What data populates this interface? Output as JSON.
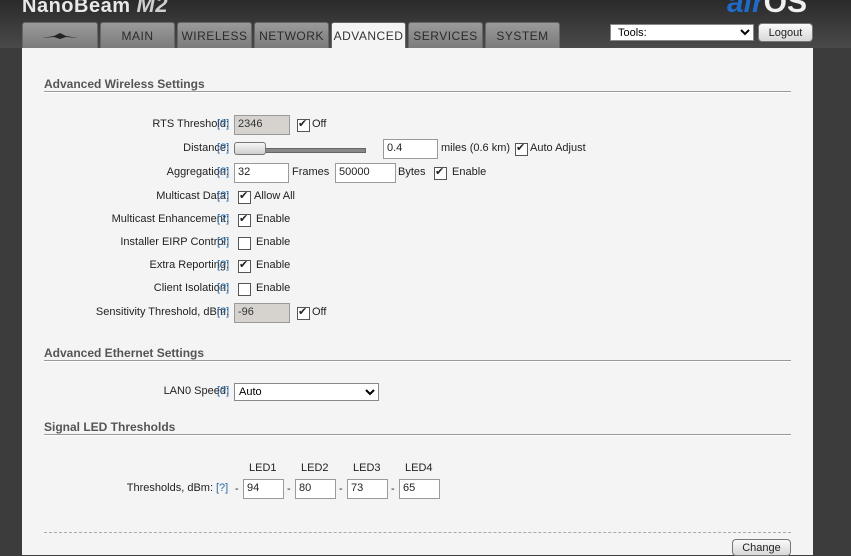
{
  "brand": {
    "name": "NanoBeam",
    "model": "M2",
    "os_logo_a": "air",
    "os_logo_b": "OS"
  },
  "tabs": [
    {
      "label": "",
      "icon": "ubiquiti-logo-icon"
    },
    {
      "label": "MAIN"
    },
    {
      "label": "WIRELESS"
    },
    {
      "label": "NETWORK"
    },
    {
      "label": "ADVANCED",
      "active": true
    },
    {
      "label": "SERVICES"
    },
    {
      "label": "SYSTEM"
    }
  ],
  "tools": {
    "selected": "Tools:"
  },
  "logout_label": "Logout",
  "help_text": "[?]",
  "wireless": {
    "title": "Advanced Wireless Settings",
    "rts": {
      "label": "RTS Threshold:",
      "value": "2346",
      "check_label": "Off",
      "checked": true
    },
    "distance": {
      "label": "Distance:",
      "value": "0.4",
      "unit": "miles (0.6 km)",
      "check_label": "Auto Adjust",
      "checked": true
    },
    "aggregation": {
      "label": "Aggregation:",
      "frames": "32",
      "frames_label": "Frames",
      "bytes": "50000",
      "bytes_label": "Bytes",
      "check_label": "Enable",
      "checked": true
    },
    "multicast_data": {
      "label": "Multicast Data:",
      "check_label": "Allow All",
      "checked": true
    },
    "multicast_enh": {
      "label": "Multicast Enhancement:",
      "check_label": "Enable",
      "checked": true
    },
    "installer_eirp": {
      "label": "Installer EIRP Control:",
      "check_label": "Enable",
      "checked": false
    },
    "extra_reporting": {
      "label": "Extra Reporting:",
      "check_label": "Enable",
      "checked": true
    },
    "client_isolation": {
      "label": "Client Isolation:",
      "check_label": "Enable",
      "checked": false
    },
    "sensitivity": {
      "label": "Sensitivity Threshold, dBm:",
      "value": "-96",
      "check_label": "Off",
      "checked": true
    }
  },
  "ethernet": {
    "title": "Advanced Ethernet Settings",
    "lan0": {
      "label": "LAN0 Speed:",
      "selected": "Auto"
    }
  },
  "led": {
    "title": "Signal LED Thresholds",
    "label": "Thresholds, dBm:",
    "headers": [
      "LED1",
      "LED2",
      "LED3",
      "LED4"
    ],
    "values": [
      "94",
      "80",
      "73",
      "65"
    ],
    "dash": "-"
  },
  "change_label": "Change"
}
